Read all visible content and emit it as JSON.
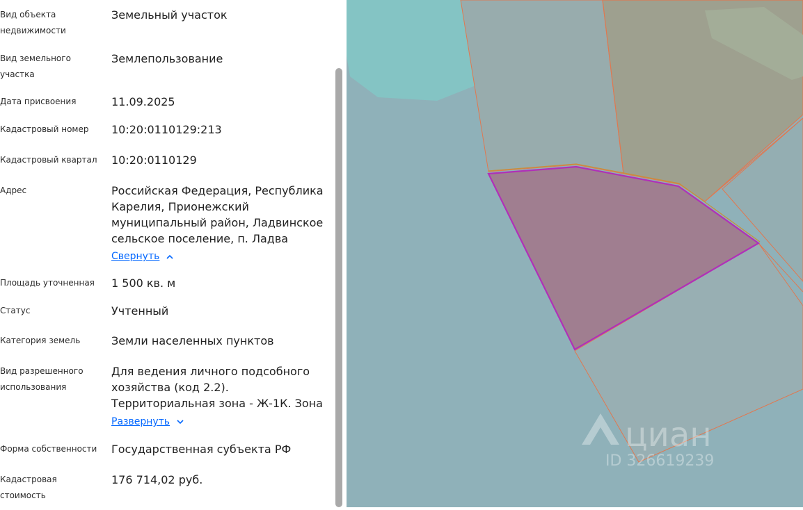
{
  "fields": [
    {
      "label": "Вид объекта недвижимости",
      "value": "Земельный участок"
    },
    {
      "label": "Вид земельного участка",
      "value": "Землепользование"
    },
    {
      "label": "Дата присвоения",
      "value": "11.09.2025"
    },
    {
      "label": "Кадастровый номер",
      "value": "10:20:0110129:213"
    },
    {
      "label": "Кадастровый квартал",
      "value": "10:20:0110129"
    },
    {
      "label": "Адрес",
      "value": "Российская Федерация, Республика Карелия, Прионежский муниципальный район, Ладвинское сельское поселение, п. Ладва",
      "toggle": "Свернуть"
    },
    {
      "label": "Площадь уточненная",
      "value": "1 500 кв. м"
    },
    {
      "label": "Статус",
      "value": "Учтенный"
    },
    {
      "label": "Категория земель",
      "value": "Земли населенных пунктов"
    },
    {
      "label": "Вид разрешенного использования",
      "value": "Для ведения личного подсобного хозяйства (код 2.2). Территориальная зона - Ж-1К. Зона",
      "toggle": "Развернуть"
    },
    {
      "label": "Форма собственности",
      "value": "Государственная субъекта РФ"
    },
    {
      "label": "Кадастровая стоимость",
      "value": "176 714,02 руб."
    }
  ],
  "map": {
    "watermark_brand": "циан",
    "watermark_id": "ID 326619239",
    "colors": {
      "water": "#84c4c4",
      "land": "#8fb1b9",
      "parcel_border": "#e07850",
      "selected_fill": "#a07e90",
      "selected_border": "#b030b8"
    }
  }
}
